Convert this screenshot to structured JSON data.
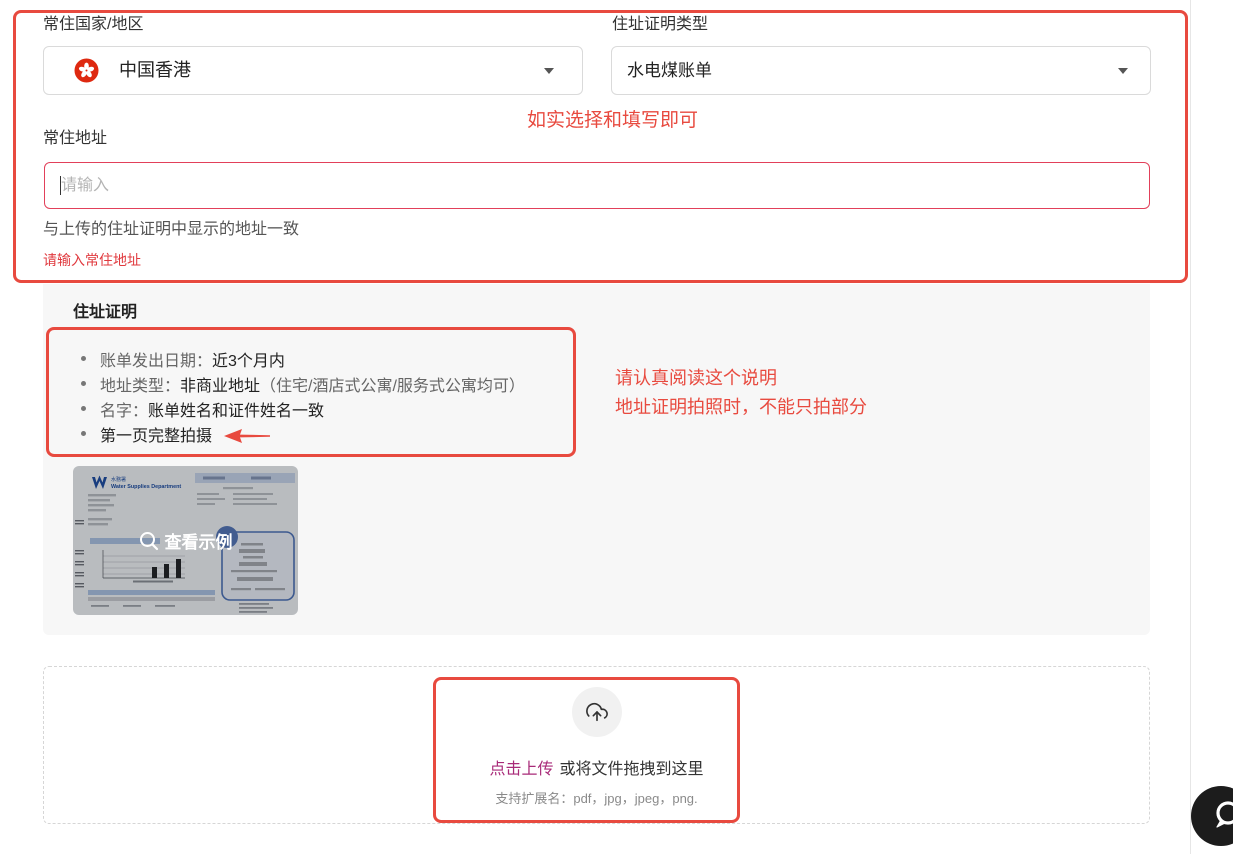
{
  "form": {
    "country": {
      "label": "常住国家/地区",
      "value": "中国香港",
      "flag_icon": "hong-kong-flag-icon",
      "dropdown_icon": "caret-down-icon"
    },
    "proof_type": {
      "label": "住址证明类型",
      "value": "水电煤账单",
      "dropdown_icon": "caret-down-icon"
    },
    "address": {
      "label": "常住地址",
      "placeholder": "请输入",
      "hint": "与上传的住址证明中显示的地址一致",
      "error": "请输入常住地址"
    }
  },
  "proof_info": {
    "title": "住址证明",
    "requirements": [
      {
        "label": "账单发出日期：",
        "value": "近3个月内"
      },
      {
        "label": "地址类型：",
        "value": "非商业地址",
        "note": "（住宅/酒店式公寓/服务式公寓均可）"
      },
      {
        "label": "名字：",
        "value": "账单姓名和证件姓名一致"
      },
      {
        "value": "第一页完整拍摄"
      }
    ],
    "example": {
      "label": "查看示例",
      "icon": "search-icon",
      "sample_bill": {
        "issuer_zh": "水務署",
        "issuer_en": "Water Supplies Department"
      }
    }
  },
  "upload": {
    "icon": "upload-cloud-icon",
    "action_label": "点击上传",
    "drag_text": "或将文件拖拽到这里",
    "extensions_text": "支持扩展名：pdf，jpg，jpeg，png."
  },
  "annotations": {
    "fill_note": "如实选择和填写即可",
    "read_note": [
      "请认真阅读这个说明",
      "地址证明拍照时，不能只拍部分"
    ],
    "arrow_icon": "arrow-left-icon"
  },
  "chat_widget": {
    "icon": "chat-icon"
  },
  "colors": {
    "annotation_red": "#e84a3f",
    "error_red": "#e0393e",
    "input_error_border": "#e2405a",
    "upload_link": "#a82a78",
    "panel_background": "#f7f7f7",
    "flag_red": "#de2910",
    "chat_background": "#1c1c1c"
  }
}
